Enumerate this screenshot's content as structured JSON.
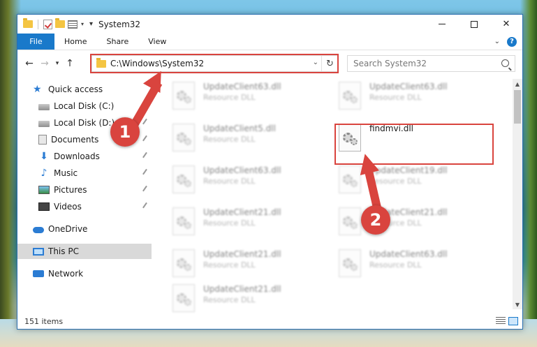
{
  "window": {
    "title": "System32",
    "controls": {
      "close": "✕"
    }
  },
  "ribbon": {
    "tabs": [
      "File",
      "Home",
      "Share",
      "View"
    ],
    "help": "?"
  },
  "address_bar": {
    "path": "C:\\Windows\\System32",
    "search_placeholder": "Search System32"
  },
  "navigation": {
    "items": [
      {
        "label": "Quick access",
        "icon": "star-icon",
        "pinned": false
      },
      {
        "label": "Local Disk (C:)",
        "icon": "disk-icon",
        "pinned": false
      },
      {
        "label": "Local Disk (D:)",
        "icon": "disk-icon",
        "pinned": true
      },
      {
        "label": "Documents",
        "icon": "documents-icon",
        "pinned": true
      },
      {
        "label": "Downloads",
        "icon": "download-icon",
        "pinned": true
      },
      {
        "label": "Music",
        "icon": "music-icon",
        "pinned": true
      },
      {
        "label": "Pictures",
        "icon": "pictures-icon",
        "pinned": true
      },
      {
        "label": "Videos",
        "icon": "videos-icon",
        "pinned": true
      },
      {
        "label": "OneDrive",
        "icon": "cloud-icon",
        "pinned": false
      },
      {
        "label": "This PC",
        "icon": "computer-icon",
        "pinned": false,
        "selected": true
      },
      {
        "label": "Network",
        "icon": "network-icon",
        "pinned": false
      }
    ]
  },
  "files": [
    {
      "name": "UpdateClient63.dll",
      "type": "Resource DLL",
      "blurred": true
    },
    {
      "name": "UpdateClient63.dll",
      "type": "Resource DLL",
      "blurred": true
    },
    {
      "name": "UpdateClient5.dll",
      "type": "Resource DLL",
      "blurred": true
    },
    {
      "name": "findmvi.dll",
      "type": "",
      "blurred": false
    },
    {
      "name": "UpdateClient63.dll",
      "type": "Resource DLL",
      "blurred": true
    },
    {
      "name": "UpdateClient19.dll",
      "type": "Resource DLL",
      "blurred": true
    },
    {
      "name": "UpdateClient21.dll",
      "type": "Resource DLL",
      "blurred": true
    },
    {
      "name": "UpdateClient21.dll",
      "type": "Resource DLL",
      "blurred": true
    },
    {
      "name": "UpdateClient21.dll",
      "type": "Resource DLL",
      "blurred": true
    },
    {
      "name": "UpdateClient63.dll",
      "type": "Resource DLL",
      "blurred": true
    },
    {
      "name": "UpdateClient21.dll",
      "type": "Resource DLL",
      "blurred": true
    }
  ],
  "status": {
    "item_count": "151 items"
  },
  "callouts": {
    "step1": "1",
    "step2": "2"
  },
  "colors": {
    "accent": "#1979ca",
    "highlight": "#d9443e",
    "selected": "#d9d9d9"
  }
}
